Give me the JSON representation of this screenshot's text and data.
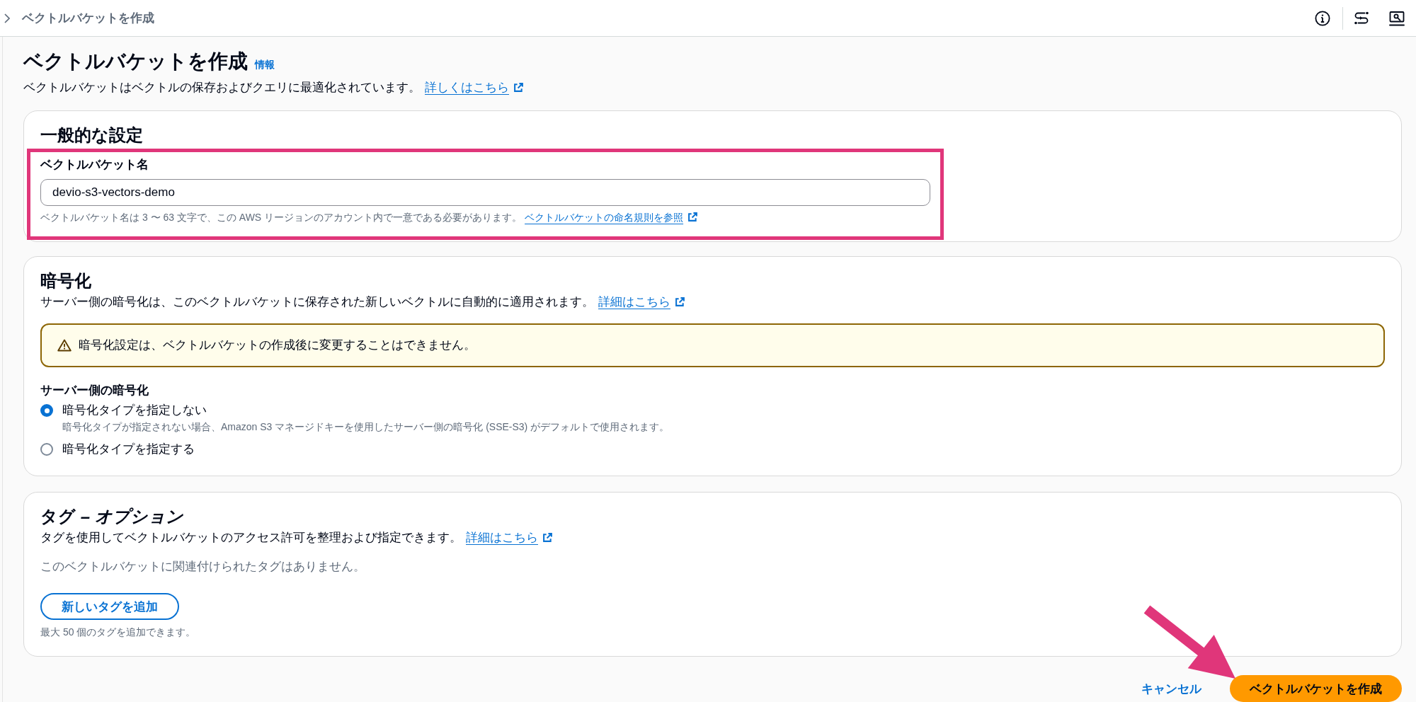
{
  "top_bar": {
    "breadcrumb": "ベクトルバケットを作成"
  },
  "header": {
    "title": "ベクトルバケットを作成",
    "info_link": "情報",
    "description": "ベクトルバケットはベクトルの保存およびクエリに最適化されています。",
    "learn_more_link": "詳しくはこちら"
  },
  "general_settings": {
    "title": "一般的な設定",
    "bucket_name": {
      "label": "ベクトルバケット名",
      "value": "devio-s3-vectors-demo",
      "hint": "ベクトルバケット名は 3 〜 63 文字で、この AWS リージョンのアカウント内で一意である必要があります。",
      "hint_link": "ベクトルバケットの命名規則を参照",
      "highlighted": true
    }
  },
  "encryption": {
    "title": "暗号化",
    "description": "サーバー側の暗号化は、このベクトルバケットに保存された新しいベクトルに自動的に適用されます。",
    "learn_more_link": "詳細はこちら",
    "warning": "暗号化設定は、ベクトルバケットの作成後に変更することはできません。",
    "server_side_encryption": {
      "label": "サーバー側の暗号化",
      "options": [
        {
          "label": "暗号化タイプを指定しない",
          "description": "暗号化タイプが指定されない場合、Amazon S3 マネージドキーを使用したサーバー側の暗号化 (SSE-S3) がデフォルトで使用されます。",
          "selected": true
        },
        {
          "label": "暗号化タイプを指定する",
          "selected": false
        }
      ]
    }
  },
  "tags": {
    "title": "タグ *– オプション*",
    "description": "タグを使用してベクトルバケットのアクセス許可を整理および指定できます。",
    "learn_more_link": "詳細はこちら",
    "empty_text": "このベクトルバケットに関連付けられたタグはありません。",
    "add_button": "新しいタグを追加",
    "limit_hint": "最大 50 個のタグを追加できます。"
  },
  "footer": {
    "cancel_button": "キャンセル",
    "create_button": {
      "label": "ベクトルバケットを作成",
      "arrow_annotation": true
    }
  }
}
